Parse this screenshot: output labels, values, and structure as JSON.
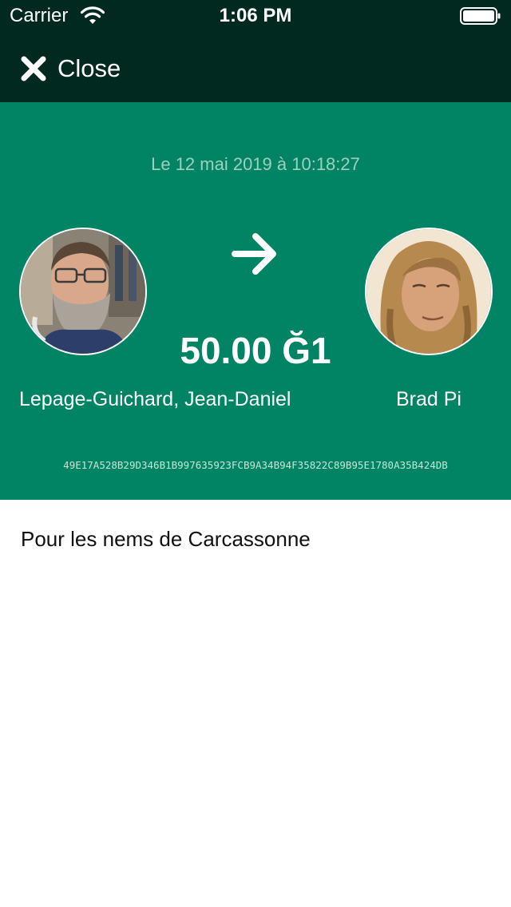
{
  "status_bar": {
    "carrier": "Carrier",
    "time": "1:06 PM",
    "wifi_icon": "wifi-icon",
    "battery_icon": "battery-icon"
  },
  "nav": {
    "close_label": "Close",
    "close_icon": "close-icon"
  },
  "transaction": {
    "date": "Le 12 mai 2019 à 10:18:27",
    "amount": "50.00 Ğ1",
    "from": {
      "name": "Lepage-Guichard, Jean-Daniel",
      "avatar": "avatar-photo"
    },
    "to": {
      "name": "Brad Pi",
      "avatar": "avatar-photo"
    },
    "direction_icon": "arrow-right-icon",
    "hash": "49E17A528B29D346B1B997635923FCB9A34B94F35822C89B95E1780A35B424DB",
    "comment": "Pour les nems de Carcassonne"
  },
  "colors": {
    "nav_background": "#02291f",
    "header_background": "#018463",
    "date_text": "#9cd0bf",
    "text_light": "#ffffff"
  }
}
